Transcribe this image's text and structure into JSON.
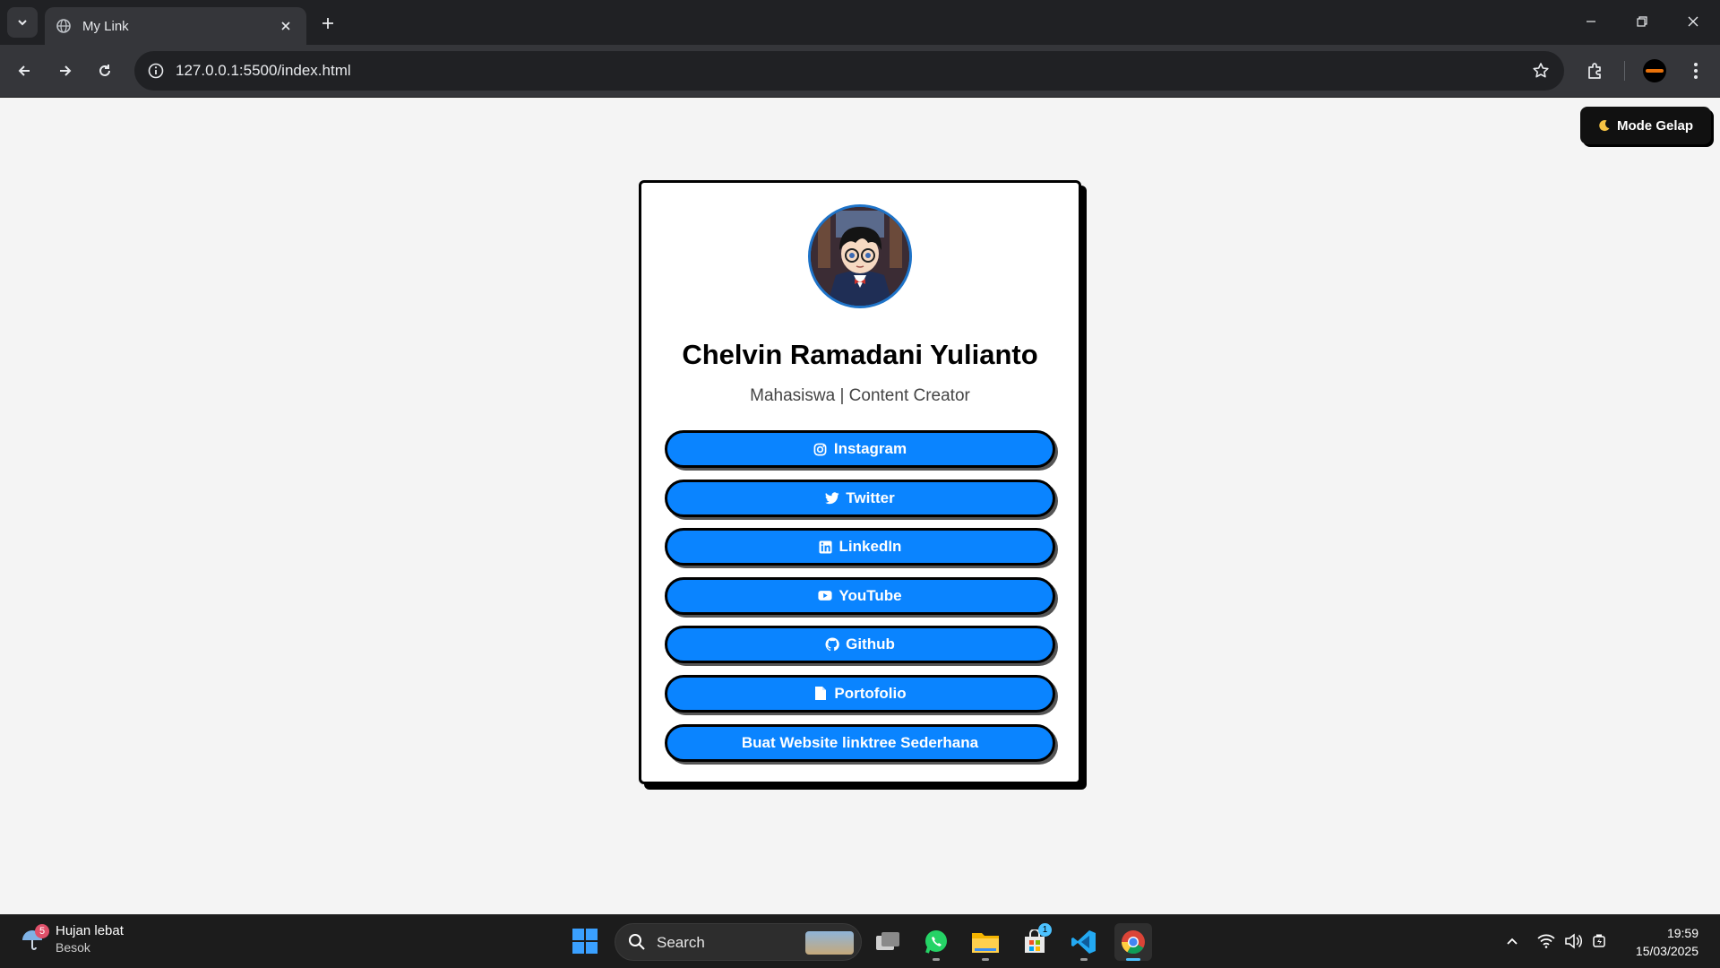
{
  "browser": {
    "tab_title": "My Link",
    "url": "127.0.0.1:5500/index.html"
  },
  "page": {
    "mode_button_label": "Mode Gelap",
    "mode_button_icon": "moon-icon",
    "profile": {
      "name": "Chelvin Ramadani Yulianto",
      "bio": "Mahasiswa | Content Creator",
      "avatar": "profile-avatar-anime"
    },
    "links": [
      {
        "label": "Instagram",
        "icon": "instagram-icon"
      },
      {
        "label": "Twitter",
        "icon": "twitter-icon"
      },
      {
        "label": "LinkedIn",
        "icon": "linkedin-icon"
      },
      {
        "label": "YouTube",
        "icon": "youtube-icon"
      },
      {
        "label": "Github",
        "icon": "github-icon"
      },
      {
        "label": "Portofolio",
        "icon": "file-icon"
      },
      {
        "label": "Buat Website linktree Sederhana",
        "icon": ""
      }
    ],
    "colors": {
      "link_button": "#0a84ff",
      "page_background": "#f4f4f4",
      "mode_button": "#111111"
    }
  },
  "taskbar": {
    "weather": {
      "title": "Hujan lebat",
      "subtitle": "Besok",
      "badge": "5"
    },
    "search_label": "Search",
    "store_badge": "1",
    "clock": {
      "time": "19:59",
      "date": "15/03/2025"
    }
  }
}
